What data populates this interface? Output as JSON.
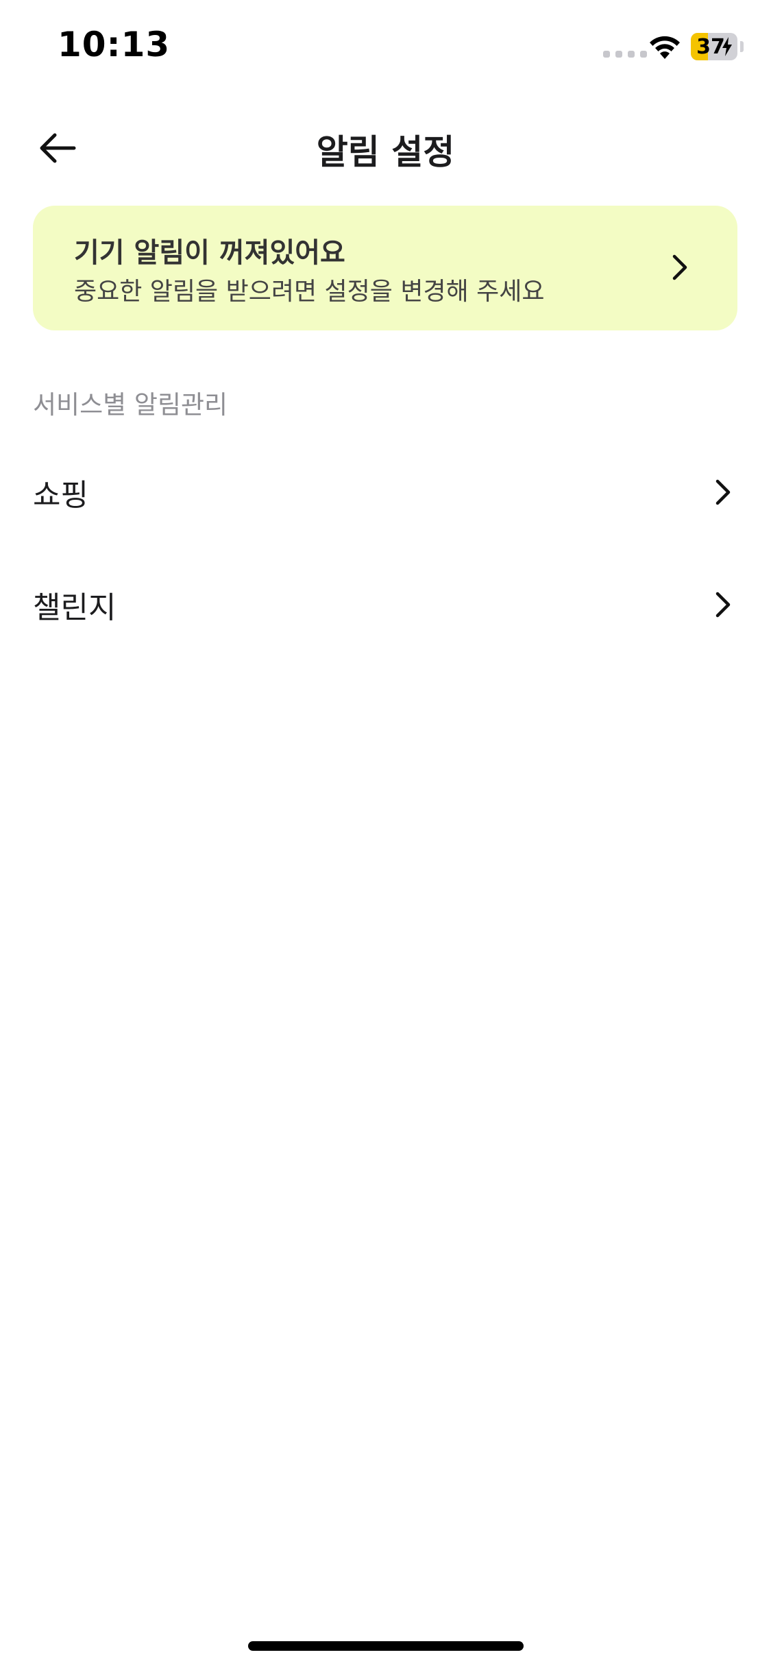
{
  "status_bar": {
    "time": "10:13",
    "battery_percent": 37,
    "battery_label": "37",
    "charging": true,
    "wifi_icon": "wifi-icon",
    "cellular_icon": "cellular-dots-icon",
    "bolt_icon": "lightning-bolt-icon",
    "battery_fill_color": "#f4c300"
  },
  "header": {
    "title": "알림 설정",
    "back_icon": "arrow-left-icon"
  },
  "banner": {
    "title": "기기 알림이 꺼져있어요",
    "subtitle": "중요한 알림을 받으려면 설정을 변경해 주세요",
    "chevron_icon": "chevron-right-icon",
    "background_color": "#f3fcc4"
  },
  "section": {
    "header": "서비스별 알림관리",
    "items": [
      {
        "label": "쇼핑",
        "chevron_icon": "chevron-right-icon"
      },
      {
        "label": "챌린지",
        "chevron_icon": "chevron-right-icon"
      }
    ]
  }
}
